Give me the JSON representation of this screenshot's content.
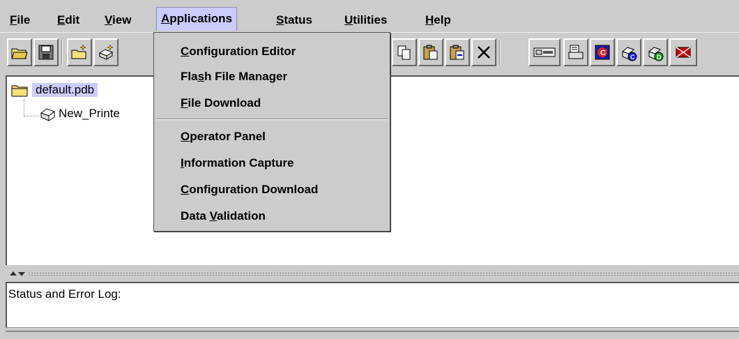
{
  "menubar": {
    "items": [
      {
        "label_pre": "",
        "label_u": "F",
        "label_post": "ile"
      },
      {
        "label_pre": "",
        "label_u": "E",
        "label_post": "dit"
      },
      {
        "label_pre": "",
        "label_u": "V",
        "label_post": "iew"
      },
      {
        "label_pre": "",
        "label_u": "A",
        "label_post": "pplications"
      },
      {
        "label_pre": "",
        "label_u": "S",
        "label_post": "tatus"
      },
      {
        "label_pre": "",
        "label_u": "U",
        "label_post": "tilities"
      },
      {
        "label_pre": "",
        "label_u": "H",
        "label_post": "elp"
      }
    ]
  },
  "applications_menu": {
    "items": [
      {
        "pre": "",
        "u": "C",
        "post": "onfiguration Editor"
      },
      {
        "pre": "Fla",
        "u": "s",
        "post": "h File Manager"
      },
      {
        "pre": "",
        "u": "F",
        "post": "ile Download"
      },
      {
        "pre": "",
        "u": "O",
        "post": "perator Panel"
      },
      {
        "pre": "",
        "u": "I",
        "post": "nformation Capture"
      },
      {
        "pre": "",
        "u": "C",
        "post": "onfiguration Download"
      },
      {
        "pre": "Data ",
        "u": "V",
        "post": "alidation"
      }
    ]
  },
  "tree": {
    "root_label": "default.pdb",
    "child_label": "New_Printe"
  },
  "log": {
    "label": "Status and Error Log:"
  },
  "colors": {
    "selection": "#ccccff",
    "background": "#cccccc"
  }
}
